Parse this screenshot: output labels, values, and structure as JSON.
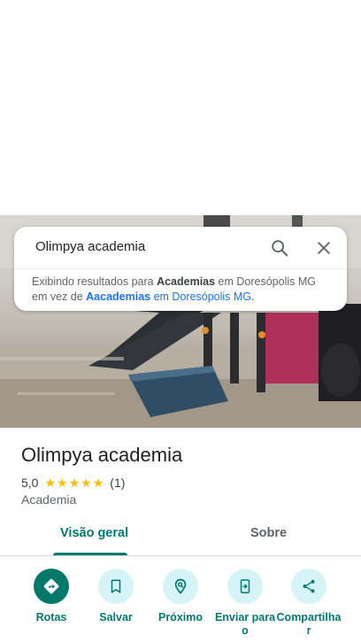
{
  "search": {
    "query": "Olimpya academia",
    "note_prefix": "Exibindo resultados para ",
    "note_term": "Academias",
    "note_mid": " em Doresópolis MG",
    "note_line2_prefix": "em vez de ",
    "note_original_term": "Aacademias",
    "note_original_loc": " em Doresópolis MG."
  },
  "place": {
    "name": "Olimpya academia",
    "rating": "5,0",
    "stars": [
      "★",
      "★",
      "★",
      "★",
      "★"
    ],
    "reviews": "(1)",
    "category": "Academia"
  },
  "tabs": {
    "overview": "Visão geral",
    "about": "Sobre"
  },
  "actions": {
    "directions": "Rotas",
    "save": "Salvar",
    "nearby": "Próximo",
    "send_line1": "Enviar para",
    "send_line2": "o",
    "share_line1": "Compartilha",
    "share_line2": "r"
  },
  "colors": {
    "accent": "#01796f",
    "action_bg": "#d6f3f8",
    "star": "#fbbc04"
  },
  "icons": [
    "search-icon",
    "close-icon",
    "directions-icon",
    "bookmark-icon",
    "nearby-icon",
    "send-to-phone-icon",
    "share-icon"
  ]
}
